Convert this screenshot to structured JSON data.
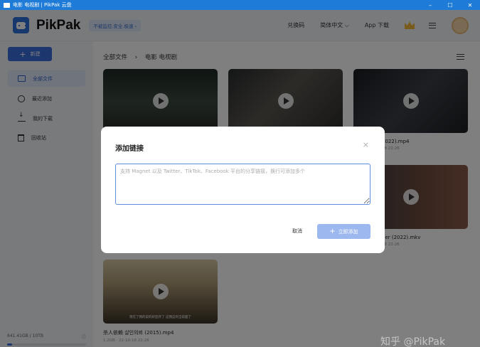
{
  "window": {
    "title": "电影 电视剧 | PikPak 云盘",
    "min_icon": "–",
    "max_icon": "☐",
    "close_icon": "✕"
  },
  "header": {
    "brand": "PikPak",
    "promo": "不被监控.安全.极速 ›",
    "redeem": "兑换码",
    "language": "简体中文 ⌵",
    "app_download": "App 下载"
  },
  "sidebar": {
    "new_label": "新建",
    "items": [
      {
        "label": "全部文件",
        "icon": "folder-icon",
        "active": true
      },
      {
        "label": "最近添加",
        "icon": "clock-icon",
        "active": false
      },
      {
        "label": "我的下载",
        "icon": "download-icon",
        "active": false
      },
      {
        "label": "回收站",
        "icon": "trash-icon",
        "active": false
      }
    ],
    "storage_text": "641.41GB / 10TB",
    "storage_info_icon": "ⓘ",
    "storage_used_fraction": 0.06
  },
  "main": {
    "breadcrumb": [
      "全部文件",
      "电影 电视剧"
    ],
    "breadcrumb_sep": "›",
    "files": [
      {
        "name": "",
        "meta": ""
      },
      {
        "name": "",
        "meta": ""
      },
      {
        "name": "2022).mp4",
        "meta": "18 22:26"
      },
      {
        "name": "",
        "meta": ""
      },
      {
        "name": "",
        "meta": ""
      },
      {
        "name": "per (2022).mkv",
        "meta": "18 22:26"
      },
      {
        "name": "杀人依赖 살인의뢰 (2015).mp4",
        "meta": "1.2GB · 22-10-18 22:26",
        "subtitle": "现在了我的说的好后开了 这我这的当前面了"
      }
    ]
  },
  "dialog": {
    "title": "添加链接",
    "close": "×",
    "placeholder": "支持 Magnet 以及 Twitter、TikTok、Facebook 平台的分享链接，换行可添加多个",
    "value": "",
    "cancel": "取消",
    "submit": "立即添加"
  },
  "watermark": "知乎 @PikPak"
}
